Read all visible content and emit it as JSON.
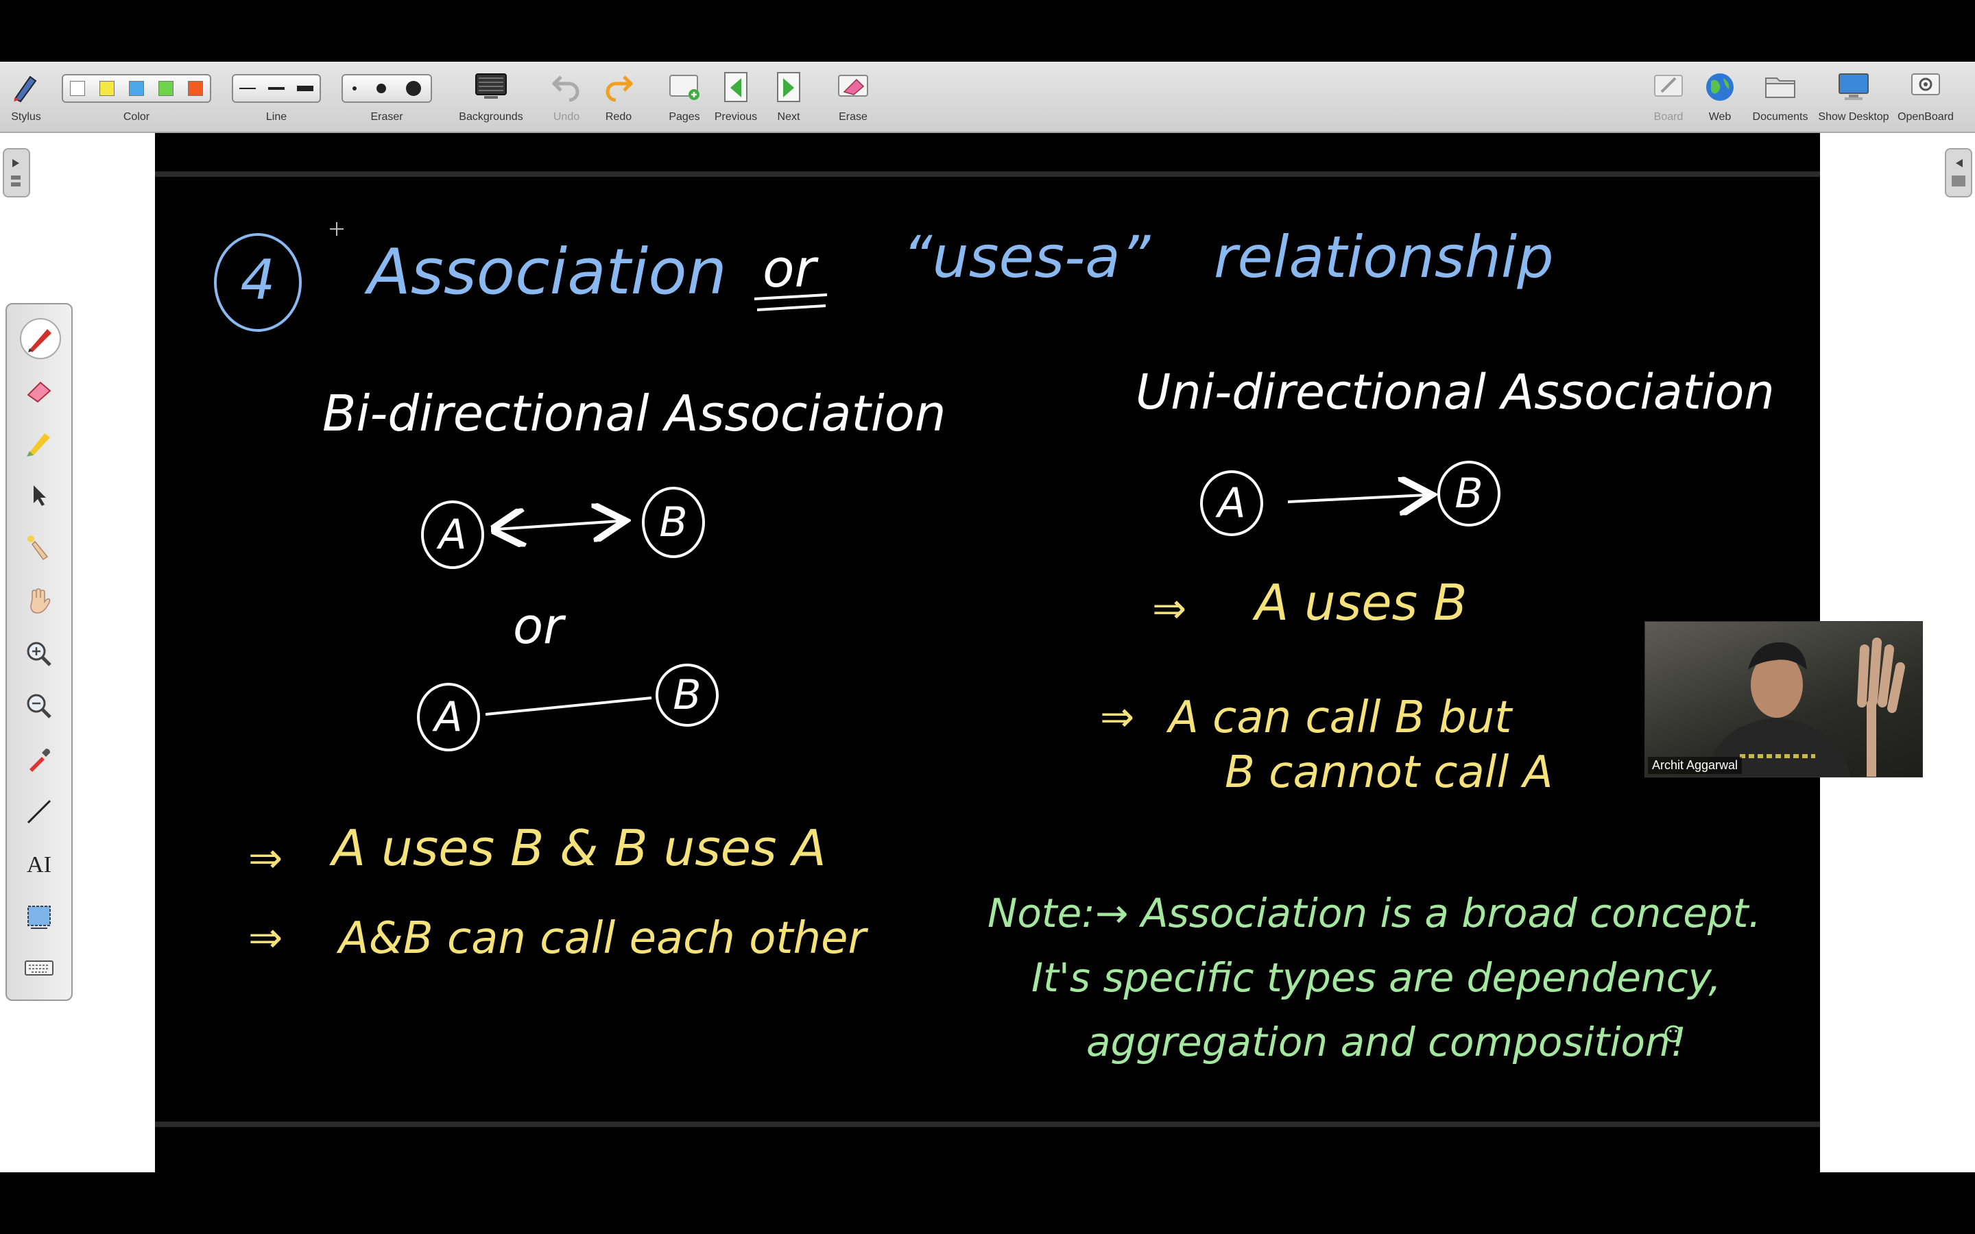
{
  "toolbar": {
    "stylus": "Stylus",
    "color": "Color",
    "line": "Line",
    "eraser": "Eraser",
    "backgrounds": "Backgrounds",
    "undo": "Undo",
    "redo": "Redo",
    "pages": "Pages",
    "previous": "Previous",
    "next": "Next",
    "erase": "Erase",
    "board": "Board",
    "web": "Web",
    "documents": "Documents",
    "show_desktop": "Show Desktop",
    "openboard": "OpenBoard",
    "swatches": [
      "#ffffff",
      "#f5e840",
      "#49a7ea",
      "#6ed24a",
      "#f25a24"
    ]
  },
  "side_palette": {
    "tools": [
      "pen-icon",
      "eraser-icon",
      "highlighter-icon",
      "pointer-icon",
      "laser-icon",
      "hand-icon",
      "zoom-in-icon",
      "zoom-out-icon",
      "pipette-icon",
      "line-icon",
      "text-icon",
      "capture-icon",
      "keyboard-icon"
    ],
    "text_tool_label": "AI"
  },
  "board": {
    "heading_number": "4",
    "heading_title": "Association",
    "heading_or": "or",
    "heading_quote": "“uses-a”",
    "heading_rel": "relationship",
    "bi_title": "Bi-directional Association",
    "uni_title": "Uni-directional Association",
    "node_a": "A",
    "node_b": "B",
    "or_text": "or",
    "bi_point_1": "A uses B & B uses A",
    "bi_point_2": "A&B can call each other",
    "uni_point_1": "A uses B",
    "uni_point_2a": "A can call B but",
    "uni_point_2b": "B cannot call A",
    "implies": "⇒",
    "note_line_1": "Note:→ Association is a broad concept.",
    "note_line_2": "It's specific types are dependency,",
    "note_line_3": "aggregation and composition!",
    "colors": {
      "blue": "#8ab8f0",
      "white": "#ffffff",
      "yellow": "#f6e27a",
      "green": "#a4e8a0"
    }
  },
  "video": {
    "participant": "Archit Aggarwal"
  }
}
